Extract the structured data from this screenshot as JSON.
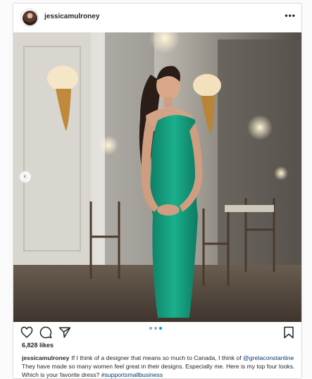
{
  "post": {
    "username": "jessicamulroney",
    "more_icon": "more-horizontal-icon"
  },
  "carousel": {
    "prev_icon": "chevron-left-icon",
    "dot_count": 3,
    "active_dot": 2
  },
  "actions": {
    "like_icon": "heart-icon",
    "comment_icon": "comment-icon",
    "share_icon": "send-icon",
    "save_icon": "bookmark-icon"
  },
  "likes": "6,828 likes",
  "caption": {
    "username": "jessicamulroney",
    "text_1": "If I think of a designer that means so much to Canada, I think of",
    "mention": "@gretaconstantine",
    "text_2": "They have made so many women feel great in their designs. Especially me. Here is my top four looks. Which is your favorite dress?",
    "hashtag": "#supportsmallbusiness"
  },
  "colors": {
    "dress": "#1aa383",
    "link": "#00376b",
    "active_dot": "#0095f6"
  }
}
